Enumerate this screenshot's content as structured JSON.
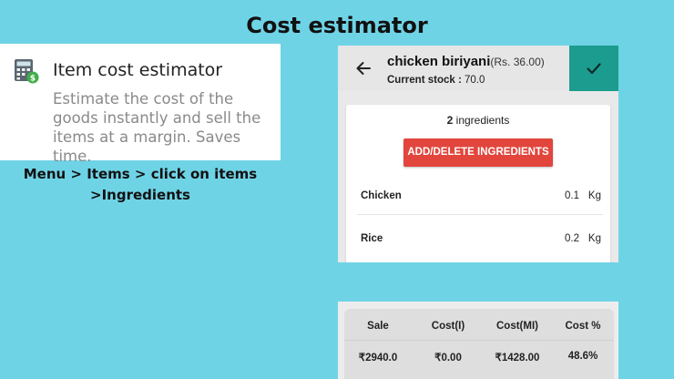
{
  "page": {
    "title": "Cost estimator"
  },
  "feature": {
    "icon": "calculator-icon",
    "title": "Item cost estimator",
    "description": "Estimate the cost of the goods instantly and sell the items at a margin. Saves time."
  },
  "navigation_path": {
    "line1": "Menu > Items > click on items",
    "line2": ">Ingredients"
  },
  "item_screen": {
    "back_icon": "back-arrow-icon",
    "item_name": "chicken biriyani",
    "item_price": "(Rs. 36.00)",
    "stock_label": "Current stock :",
    "stock_value": "70.0",
    "confirm_icon": "check-icon",
    "confirm_color": "#1b9c8e",
    "ingredient_count": "2",
    "ingredient_count_label": "ingredients",
    "add_button_label": "ADD/DELETE INGREDIENTS",
    "add_button_color": "#e2453c",
    "ingredients": [
      {
        "name": "Chicken",
        "qty": "0.1",
        "unit": "Kg"
      },
      {
        "name": "Rice",
        "qty": "0.2",
        "unit": "Kg"
      }
    ]
  },
  "summary": {
    "headers": [
      "Sale",
      "Cost(I)",
      "Cost(MI)",
      "Cost %"
    ],
    "values": [
      "₹2940.0",
      "₹0.00",
      "₹1428.00",
      "48.6%"
    ]
  }
}
